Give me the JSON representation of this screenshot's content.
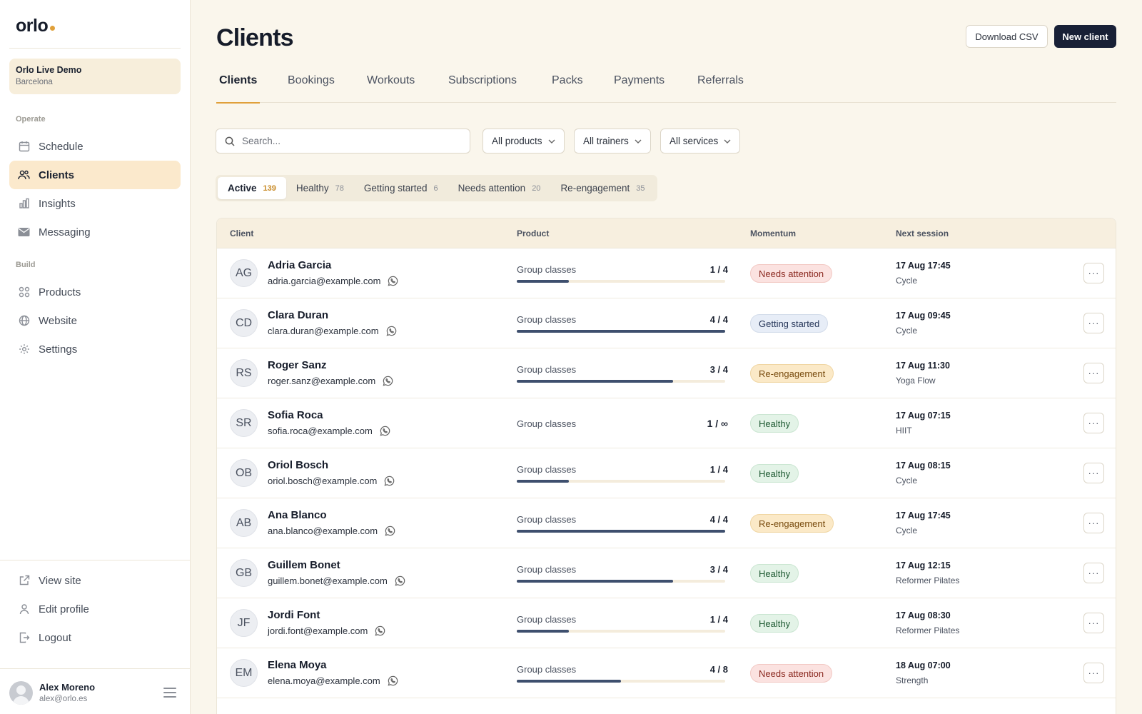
{
  "app": {
    "logo": "orlo"
  },
  "studio": {
    "name": "Orlo Live Demo",
    "city": "Barcelona"
  },
  "sidebar": {
    "sections": {
      "operate": "Operate",
      "build": "Build"
    },
    "items": [
      {
        "label": "Schedule",
        "icon": "calendar-icon"
      },
      {
        "label": "Clients",
        "icon": "users-icon"
      },
      {
        "label": "Insights",
        "icon": "bar-chart-icon"
      },
      {
        "label": "Messaging",
        "icon": "mail-icon"
      },
      {
        "label": "Products",
        "icon": "grid-icon"
      },
      {
        "label": "Website",
        "icon": "globe-icon"
      },
      {
        "label": "Settings",
        "icon": "gear-icon"
      }
    ],
    "bottom": [
      {
        "label": "View site",
        "icon": "external-link-icon"
      },
      {
        "label": "Edit profile",
        "icon": "user-icon"
      },
      {
        "label": "Logout",
        "icon": "logout-icon"
      }
    ],
    "user": {
      "name": "Alex Moreno",
      "email": "alex@orlo.es"
    }
  },
  "header": {
    "title": "Clients",
    "download_label": "Download CSV",
    "new_label": "New client"
  },
  "tabs": [
    "Clients",
    "Bookings",
    "Workouts",
    "Subscriptions",
    "Packs",
    "Payments",
    "Referrals"
  ],
  "filters": {
    "search_placeholder": "Search...",
    "products": "All products",
    "trainers": "All trainers",
    "services": "All services"
  },
  "segments": [
    {
      "label": "Active",
      "count": "139"
    },
    {
      "label": "Healthy",
      "count": "78"
    },
    {
      "label": "Getting started",
      "count": "6"
    },
    {
      "label": "Needs attention",
      "count": "20"
    },
    {
      "label": "Re-engagement",
      "count": "35"
    }
  ],
  "table": {
    "columns": {
      "client": "Client",
      "product": "Product",
      "momentum": "Momentum",
      "next": "Next session"
    },
    "more_label": "···",
    "rows": [
      {
        "initials": "AG",
        "name": "Adria Garcia",
        "email": "adria.garcia@example.com",
        "product": "Group classes",
        "used": "1 / 4",
        "progress": 0.25,
        "momentum": "Needs attention",
        "status": "needs",
        "session": "17 Aug 17:45",
        "type": "Cycle"
      },
      {
        "initials": "CD",
        "name": "Clara Duran",
        "email": "clara.duran@example.com",
        "product": "Group classes",
        "used": "4 / 4",
        "progress": 1.0,
        "momentum": "Getting started",
        "status": "getting",
        "session": "17 Aug 09:45",
        "type": "Cycle"
      },
      {
        "initials": "RS",
        "name": "Roger Sanz",
        "email": "roger.sanz@example.com",
        "product": "Group classes",
        "used": "3 / 4",
        "progress": 0.75,
        "momentum": "Re-engagement",
        "status": "reeng",
        "session": "17 Aug 11:30",
        "type": "Yoga Flow"
      },
      {
        "initials": "SR",
        "name": "Sofia Roca",
        "email": "sofia.roca@example.com",
        "product": "Group classes",
        "used": "1 / ∞",
        "progress": null,
        "momentum": "Healthy",
        "status": "healthy",
        "session": "17 Aug 07:15",
        "type": "HIIT"
      },
      {
        "initials": "OB",
        "name": "Oriol Bosch",
        "email": "oriol.bosch@example.com",
        "product": "Group classes",
        "used": "1 / 4",
        "progress": 0.25,
        "momentum": "Healthy",
        "status": "healthy",
        "session": "17 Aug 08:15",
        "type": "Cycle"
      },
      {
        "initials": "AB",
        "name": "Ana Blanco",
        "email": "ana.blanco@example.com",
        "product": "Group classes",
        "used": "4 / 4",
        "progress": 1.0,
        "momentum": "Re-engagement",
        "status": "reeng",
        "session": "17 Aug 17:45",
        "type": "Cycle"
      },
      {
        "initials": "GB",
        "name": "Guillem Bonet",
        "email": "guillem.bonet@example.com",
        "product": "Group classes",
        "used": "3 / 4",
        "progress": 0.75,
        "momentum": "Healthy",
        "status": "healthy",
        "session": "17 Aug 12:15",
        "type": "Reformer Pilates"
      },
      {
        "initials": "JF",
        "name": "Jordi Font",
        "email": "jordi.font@example.com",
        "product": "Group classes",
        "used": "1 / 4",
        "progress": 0.25,
        "momentum": "Healthy",
        "status": "healthy",
        "session": "17 Aug 08:30",
        "type": "Reformer Pilates"
      },
      {
        "initials": "EM",
        "name": "Elena Moya",
        "email": "elena.moya@example.com",
        "product": "Group classes",
        "used": "4 / 8",
        "progress": 0.5,
        "momentum": "Needs attention",
        "status": "needs",
        "session": "18 Aug 07:00",
        "type": "Strength"
      }
    ]
  }
}
